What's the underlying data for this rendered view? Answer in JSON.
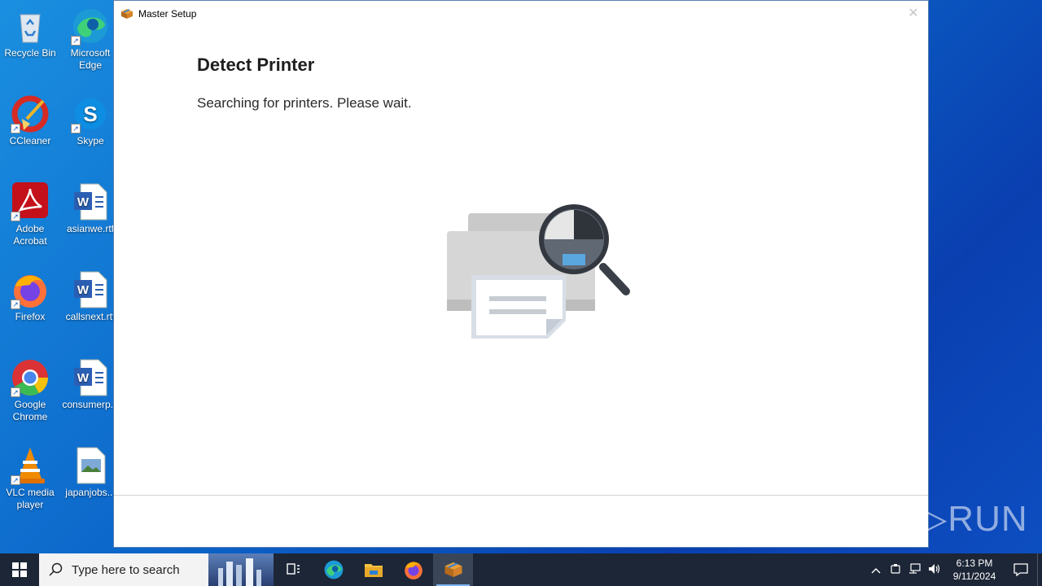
{
  "desktop": {
    "icons": [
      {
        "label": "Recycle Bin"
      },
      {
        "label": "Microsoft Edge"
      },
      {
        "label": "CCleaner"
      },
      {
        "label": "Skype"
      },
      {
        "label": "Adobe Acrobat"
      },
      {
        "label": "asianwe.rtf"
      },
      {
        "label": "Firefox"
      },
      {
        "label": "callsnext.rtf"
      },
      {
        "label": "Google Chrome"
      },
      {
        "label": "consumerp..."
      },
      {
        "label": "VLC media player"
      },
      {
        "label": "japanjobs..."
      }
    ]
  },
  "window": {
    "title": "Master Setup",
    "close_glyph": "✕",
    "heading": "Detect Printer",
    "subtext": "Searching for printers. Please wait."
  },
  "watermark": "ANY▷RUN",
  "taskbar": {
    "search_placeholder": "Type here to search",
    "clock_time": "6:13 PM",
    "clock_date": "9/11/2024"
  }
}
